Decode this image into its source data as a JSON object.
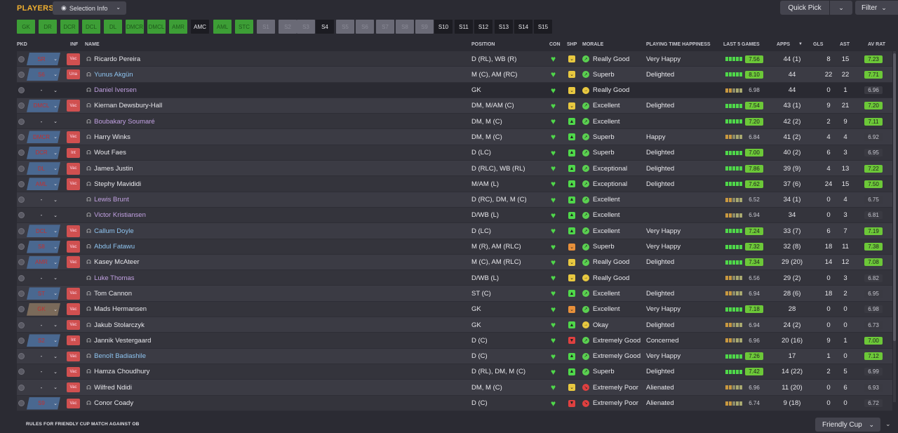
{
  "title": "PLAYERS",
  "selection_info": "Selection Info",
  "quick_pick": "Quick Pick",
  "filter": "Filter",
  "colors": {
    "on": "#3d9e36",
    "gray": "#6a6a76",
    "accent": "#f0b030"
  },
  "chips": [
    {
      "label": "GK",
      "state": "on"
    },
    {
      "label": "DR",
      "state": "on"
    },
    {
      "label": "DCR",
      "state": "on"
    },
    {
      "label": "DCL",
      "state": "on"
    },
    {
      "label": "DL",
      "state": "on"
    },
    {
      "label": "DMCR",
      "state": "on"
    },
    {
      "label": "DMCL",
      "state": "on"
    },
    {
      "label": "AMR",
      "state": "on"
    },
    {
      "label": "AMC",
      "state": "sel"
    },
    {
      "label": "AML",
      "state": "on"
    },
    {
      "label": "STC",
      "state": "on"
    },
    {
      "label": "S1",
      "state": "gray"
    },
    {
      "label": "S2",
      "state": "gray"
    },
    {
      "label": "S3",
      "state": "gray"
    },
    {
      "label": "S4",
      "state": "sel"
    },
    {
      "label": "S5",
      "state": "gray"
    },
    {
      "label": "S6",
      "state": "gray"
    },
    {
      "label": "S7",
      "state": "gray"
    },
    {
      "label": "S8",
      "state": "gray"
    },
    {
      "label": "S9",
      "state": "gray"
    },
    {
      "label": "S10",
      "state": "sel"
    },
    {
      "label": "S11",
      "state": "sel"
    },
    {
      "label": "S12",
      "state": "sel"
    },
    {
      "label": "S13",
      "state": "sel"
    },
    {
      "label": "S14",
      "state": "sel"
    },
    {
      "label": "S15",
      "state": "sel"
    }
  ],
  "columns": {
    "pkd": "PKD",
    "inf": "INF",
    "name": "NAME",
    "position": "POSITION",
    "con": "CON",
    "shp": "SHP",
    "morale": "MORALE",
    "pth": "PLAYING TIME HAPPINESS",
    "l5": "LAST 5 GAMES",
    "apps": "APPS",
    "gls": "GLS",
    "ast": "AST",
    "avr": "AV RAT"
  },
  "players": [
    {
      "pkd": "SR",
      "pkdstyle": "blue",
      "inf": "Vac",
      "name": "Ricardo Pereira",
      "ncolor": "",
      "pos": "D (RL), WB (R)",
      "shp": "y",
      "morale": "Really Good",
      "mi": "g",
      "pth": "Very Happy",
      "l5": "7.56",
      "l5c": "g",
      "apps": "44 (1)",
      "gls": "8",
      "ast": "15",
      "avr": "7.23",
      "avc": "g"
    },
    {
      "pkd": "S6",
      "pkdstyle": "blue",
      "inf": "Una",
      "name": "Yunus Akgün",
      "ncolor": "blue",
      "pos": "M (C), AM (RC)",
      "shp": "y",
      "morale": "Superb",
      "mi": "g",
      "pth": "Delighted",
      "l5": "8.10",
      "l5c": "g",
      "apps": "44",
      "gls": "22",
      "ast": "22",
      "avr": "7.71",
      "avc": "g"
    },
    {
      "pkd": "-",
      "pkdstyle": "none",
      "inf": "",
      "name": "Daniel Iversen",
      "ncolor": "purple",
      "pos": "GK",
      "shp": "y",
      "morale": "Really Good",
      "mi": "y",
      "pth": "",
      "l5": "6.98",
      "l5c": "n",
      "apps": "44",
      "gls": "0",
      "ast": "1",
      "avr": "6.96",
      "avc": "n"
    },
    {
      "pkd": "DMCL",
      "pkdstyle": "blue",
      "inf": "Vac",
      "name": "Kiernan Dewsbury-Hall",
      "ncolor": "",
      "pos": "DM, M/AM (C)",
      "shp": "y",
      "morale": "Excellent",
      "mi": "g",
      "pth": "Delighted",
      "l5": "7.54",
      "l5c": "g",
      "apps": "43 (1)",
      "gls": "9",
      "ast": "21",
      "avr": "7.20",
      "avc": "g"
    },
    {
      "pkd": "-",
      "pkdstyle": "none",
      "inf": "",
      "name": "Boubakary Soumaré",
      "ncolor": "purple",
      "pos": "DM, M (C)",
      "shp": "g",
      "morale": "Excellent",
      "mi": "g",
      "pth": "",
      "l5": "7.20",
      "l5c": "g",
      "apps": "42 (2)",
      "gls": "2",
      "ast": "9",
      "avr": "7.11",
      "avc": "g"
    },
    {
      "pkd": "DMCR",
      "pkdstyle": "blue",
      "inf": "Vac",
      "name": "Harry Winks",
      "ncolor": "",
      "pos": "DM, M (C)",
      "shp": "g",
      "morale": "Superb",
      "mi": "g",
      "pth": "Happy",
      "l5": "6.84",
      "l5c": "n",
      "apps": "41 (2)",
      "gls": "4",
      "ast": "4",
      "avr": "6.92",
      "avc": "n"
    },
    {
      "pkd": "DCR",
      "pkdstyle": "blue",
      "inf": "Int",
      "name": "Wout Faes",
      "ncolor": "",
      "pos": "D (LC)",
      "shp": "g",
      "morale": "Superb",
      "mi": "g",
      "pth": "Delighted",
      "l5": "7.00",
      "l5c": "g",
      "apps": "40 (2)",
      "gls": "6",
      "ast": "3",
      "avr": "6.95",
      "avc": "n"
    },
    {
      "pkd": "DL",
      "pkdstyle": "blue",
      "inf": "Vac",
      "name": "James Justin",
      "ncolor": "",
      "pos": "D (RLC), WB (RL)",
      "shp": "g",
      "morale": "Exceptional",
      "mi": "g",
      "pth": "Delighted",
      "l5": "7.86",
      "l5c": "g",
      "apps": "39 (9)",
      "gls": "4",
      "ast": "13",
      "avr": "7.22",
      "avc": "g"
    },
    {
      "pkd": "AML",
      "pkdstyle": "blue",
      "inf": "Vac",
      "name": "Stephy Mavididi",
      "ncolor": "",
      "pos": "M/AM (L)",
      "shp": "g",
      "morale": "Exceptional",
      "mi": "g",
      "pth": "Delighted",
      "l5": "7.62",
      "l5c": "g",
      "apps": "37 (6)",
      "gls": "24",
      "ast": "15",
      "avr": "7.50",
      "avc": "g"
    },
    {
      "pkd": "-",
      "pkdstyle": "none",
      "inf": "",
      "name": "Lewis Brunt",
      "ncolor": "purple",
      "pos": "D (RC), DM, M (C)",
      "shp": "g",
      "morale": "Excellent",
      "mi": "g",
      "pth": "",
      "l5": "6.52",
      "l5c": "n",
      "apps": "34 (1)",
      "gls": "0",
      "ast": "4",
      "avr": "6.75",
      "avc": "n"
    },
    {
      "pkd": "-",
      "pkdstyle": "none",
      "inf": "",
      "name": "Victor Kristiansen",
      "ncolor": "purple",
      "pos": "D/WB (L)",
      "shp": "g",
      "morale": "Excellent",
      "mi": "g",
      "pth": "",
      "l5": "6.94",
      "l5c": "n",
      "apps": "34",
      "gls": "0",
      "ast": "3",
      "avr": "6.81",
      "avc": "n"
    },
    {
      "pkd": "DCL",
      "pkdstyle": "blue",
      "inf": "Vac",
      "name": "Callum Doyle",
      "ncolor": "blue",
      "pos": "D (LC)",
      "shp": "g",
      "morale": "Excellent",
      "mi": "g",
      "pth": "Very Happy",
      "l5": "7.24",
      "l5c": "g",
      "apps": "33 (7)",
      "gls": "6",
      "ast": "7",
      "avr": "7.19",
      "avc": "g"
    },
    {
      "pkd": "S8",
      "pkdstyle": "blue",
      "inf": "Vac",
      "name": "Abdul Fatawu",
      "ncolor": "blue",
      "pos": "M (R), AM (RLC)",
      "shp": "o",
      "morale": "Superb",
      "mi": "g",
      "pth": "Very Happy",
      "l5": "7.32",
      "l5c": "g",
      "apps": "32 (8)",
      "gls": "18",
      "ast": "11",
      "avr": "7.38",
      "avc": "g"
    },
    {
      "pkd": "AMR",
      "pkdstyle": "blue",
      "inf": "Vac",
      "name": "Kasey McAteer",
      "ncolor": "",
      "pos": "M (C), AM (RLC)",
      "shp": "y",
      "morale": "Really Good",
      "mi": "g",
      "pth": "Delighted",
      "l5": "7.34",
      "l5c": "g",
      "apps": "29 (20)",
      "gls": "14",
      "ast": "12",
      "avr": "7.08",
      "avc": "g"
    },
    {
      "pkd": "-",
      "pkdstyle": "none",
      "inf": "",
      "name": "Luke Thomas",
      "ncolor": "purple",
      "pos": "D/WB (L)",
      "shp": "y",
      "morale": "Really Good",
      "mi": "y",
      "pth": "",
      "l5": "6.56",
      "l5c": "n",
      "apps": "29 (2)",
      "gls": "0",
      "ast": "3",
      "avr": "6.82",
      "avc": "n"
    },
    {
      "pkd": "ST",
      "pkdstyle": "blue",
      "inf": "Vac",
      "name": "Tom Cannon",
      "ncolor": "",
      "pos": "ST (C)",
      "shp": "g",
      "morale": "Excellent",
      "mi": "g",
      "pth": "Delighted",
      "l5": "6.94",
      "l5c": "n",
      "apps": "28 (6)",
      "gls": "18",
      "ast": "2",
      "avr": "6.95",
      "avc": "n"
    },
    {
      "pkd": "GK",
      "pkdstyle": "orange",
      "inf": "Vac",
      "name": "Mads Hermansen",
      "ncolor": "",
      "pos": "GK",
      "shp": "o",
      "morale": "Excellent",
      "mi": "g",
      "pth": "Very Happy",
      "l5": "7.18",
      "l5c": "g",
      "apps": "28",
      "gls": "0",
      "ast": "0",
      "avr": "6.98",
      "avc": "n"
    },
    {
      "pkd": "-",
      "pkdstyle": "none",
      "inf": "Vac",
      "name": "Jakub Stolarczyk",
      "ncolor": "",
      "pos": "GK",
      "shp": "g",
      "morale": "Okay",
      "mi": "y",
      "pth": "Delighted",
      "l5": "6.94",
      "l5c": "n",
      "apps": "24 (2)",
      "gls": "0",
      "ast": "0",
      "avr": "6.73",
      "avc": "n"
    },
    {
      "pkd": "S2",
      "pkdstyle": "blue",
      "inf": "Int",
      "name": "Jannik Vestergaard",
      "ncolor": "",
      "pos": "D (C)",
      "shp": "r",
      "morale": "Extremely Good",
      "mi": "g",
      "pth": "Concerned",
      "l5": "6.96",
      "l5c": "n",
      "apps": "20 (16)",
      "gls": "9",
      "ast": "1",
      "avr": "7.00",
      "avc": "g"
    },
    {
      "pkd": "-",
      "pkdstyle": "none",
      "inf": "Vac",
      "name": "Benoît Badiashile",
      "ncolor": "blue",
      "pos": "D (C)",
      "shp": "g",
      "morale": "Extremely Good",
      "mi": "g",
      "pth": "Very Happy",
      "l5": "7.26",
      "l5c": "g",
      "apps": "17",
      "gls": "1",
      "ast": "0",
      "avr": "7.12",
      "avc": "g"
    },
    {
      "pkd": "-",
      "pkdstyle": "none",
      "inf": "Vac",
      "name": "Hamza Choudhury",
      "ncolor": "",
      "pos": "D (RL), DM, M (C)",
      "shp": "g",
      "morale": "Superb",
      "mi": "g",
      "pth": "Delighted",
      "l5": "7.42",
      "l5c": "g",
      "apps": "14 (22)",
      "gls": "2",
      "ast": "5",
      "avr": "6.99",
      "avc": "n"
    },
    {
      "pkd": "-",
      "pkdstyle": "none",
      "inf": "Vac",
      "name": "Wilfred Ndidi",
      "ncolor": "",
      "pos": "DM, M (C)",
      "shp": "y",
      "morale": "Extremely Poor",
      "mi": "r",
      "pth": "Alienated",
      "l5": "6.96",
      "l5c": "n",
      "apps": "11 (20)",
      "gls": "0",
      "ast": "6",
      "avr": "6.93",
      "avc": "n"
    },
    {
      "pkd": "S9",
      "pkdstyle": "blue",
      "inf": "Vac",
      "name": "Conor Coady",
      "ncolor": "",
      "pos": "D (C)",
      "shp": "r",
      "morale": "Extremely Poor",
      "mi": "r",
      "pth": "Alienated",
      "l5": "6.74",
      "l5c": "n",
      "apps": "9 (18)",
      "gls": "0",
      "ast": "0",
      "avr": "6.72",
      "avc": "n"
    }
  ],
  "footer": {
    "rules": "RULES FOR FRIENDLY CUP MATCH AGAINST OB",
    "cup": "Friendly Cup"
  }
}
